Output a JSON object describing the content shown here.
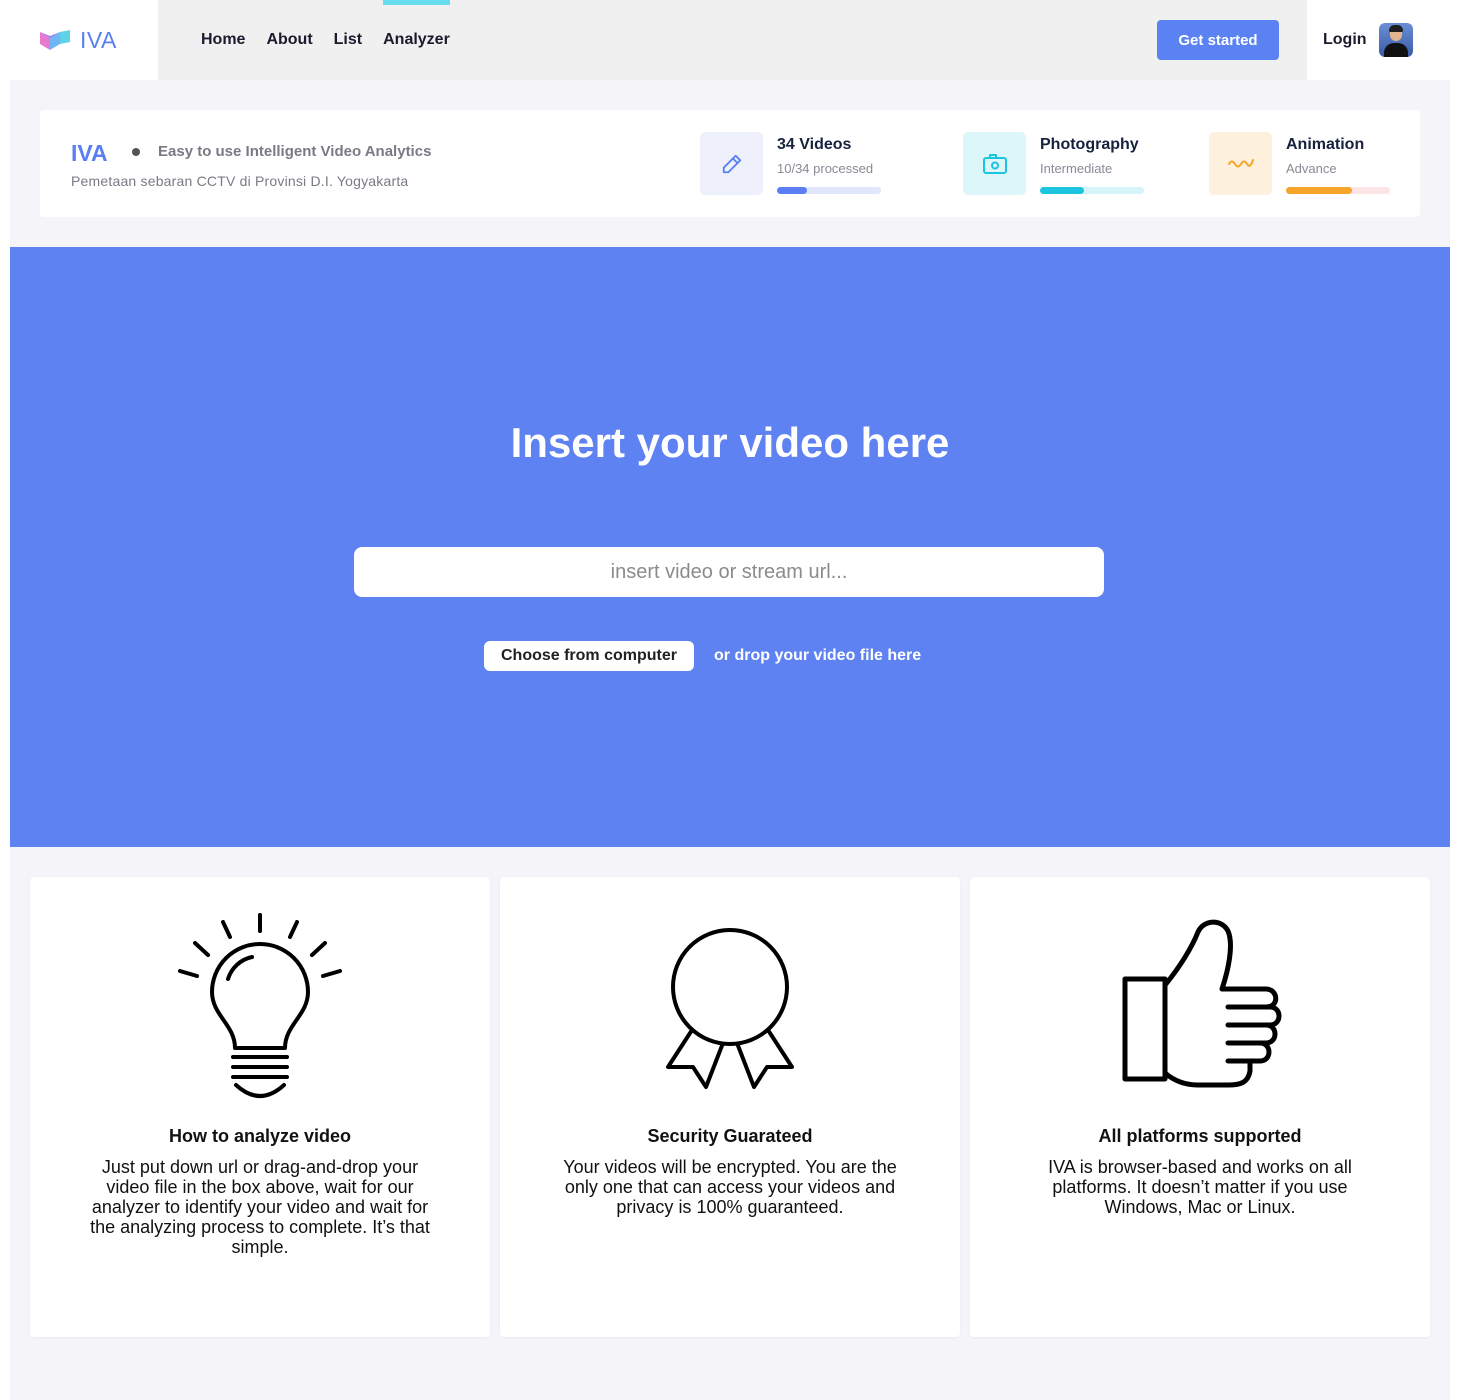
{
  "header": {
    "logo_text": "IVA",
    "nav": [
      {
        "label": "Home"
      },
      {
        "label": "About"
      },
      {
        "label": "List"
      },
      {
        "label": "Analyzer",
        "active": true
      }
    ],
    "get_started_label": "Get started",
    "login_label": "Login",
    "accent_color": "#5b82f2",
    "active_indicator_color": "#66ddf0"
  },
  "info": {
    "title": "IVA",
    "tagline": "Easy to use Intelligent Video Analytics",
    "subtitle": "Pemetaan sebaran CCTV di Provinsi D.I. Yogyakarta",
    "stats": [
      {
        "icon": "pencil-icon",
        "title": "34 Videos",
        "subtitle": "10/34 processed",
        "progress": 0.29,
        "color": "#5b7ff2",
        "track_color": "#e0e6fb",
        "bg_color": "#eef1fc"
      },
      {
        "icon": "camera-icon",
        "title": "Photography",
        "subtitle": "Intermediate",
        "progress": 0.42,
        "color": "#1bc5e0",
        "track_color": "#d6f5fa",
        "bg_color": "#ddf6fa"
      },
      {
        "icon": "wave-icon",
        "title": "Animation",
        "subtitle": "Advance",
        "progress": 0.63,
        "color": "#f7a52a",
        "track_color": "#fde4e6",
        "bg_color": "#fdf1dd"
      }
    ]
  },
  "hero": {
    "title": "Insert your video here",
    "input_placeholder": "insert video or stream url...",
    "choose_label": "Choose from computer",
    "drop_text": "or drop your video file here",
    "bg_color": "#5f82f2"
  },
  "features": [
    {
      "icon": "lightbulb-icon",
      "title": "How to analyze video",
      "text": "Just put down url or drag-and-drop your video file in the box above, wait for our analyzer to identify your video and wait for the analyzing process to complete. It’s that simple."
    },
    {
      "icon": "award-ribbon-icon",
      "title": "Security Guarateed",
      "text": "Your videos will be encrypted. You are the only one that can access your videos and privacy is 100% guaranteed."
    },
    {
      "icon": "thumbs-up-icon",
      "title": "All platforms supported",
      "text": "IVA is browser-based and works on all platforms. It doesn’t matter if you use Windows, Mac or Linux."
    }
  ]
}
